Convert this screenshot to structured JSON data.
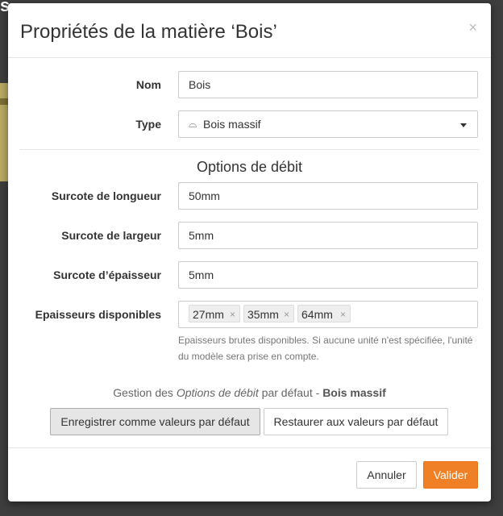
{
  "background": {
    "title_fragment": "s"
  },
  "modal": {
    "title": "Propriétés de la matière ‘Bois’",
    "close_glyph": "×"
  },
  "form": {
    "name": {
      "label": "Nom",
      "value": "Bois"
    },
    "type": {
      "label": "Type",
      "icon": "wood-icon",
      "icon_glyph": "⌓",
      "value": "Bois massif"
    },
    "section_title": "Options de débit",
    "length_allowance": {
      "label": "Surcote de longueur",
      "value": "50mm"
    },
    "width_allowance": {
      "label": "Surcote de largeur",
      "value": "5mm"
    },
    "thickness_allowance": {
      "label": "Surcote d’épaisseur",
      "value": "5mm"
    },
    "thicknesses": {
      "label": "Epaisseurs disponibles",
      "tags": [
        "27mm",
        "35mm",
        "64mm"
      ],
      "remove_glyph": "×",
      "help": "Epaisseurs brutes disponibles. Si aucune unité n'est spécifiée, l'unité du modèle sera prise en compte."
    }
  },
  "defaults": {
    "prefix": "Gestion des ",
    "emphasis": "Options de débit",
    "middle": " par défaut - ",
    "strong": "Bois massif",
    "save_label": "Enregistrer comme valeurs par défaut",
    "restore_label": "Restaurer aux valeurs par défaut"
  },
  "footer": {
    "cancel_label": "Annuler",
    "validate_label": "Valider"
  },
  "colors": {
    "primary": "#f08026",
    "overlay": "#3e3e3e"
  }
}
